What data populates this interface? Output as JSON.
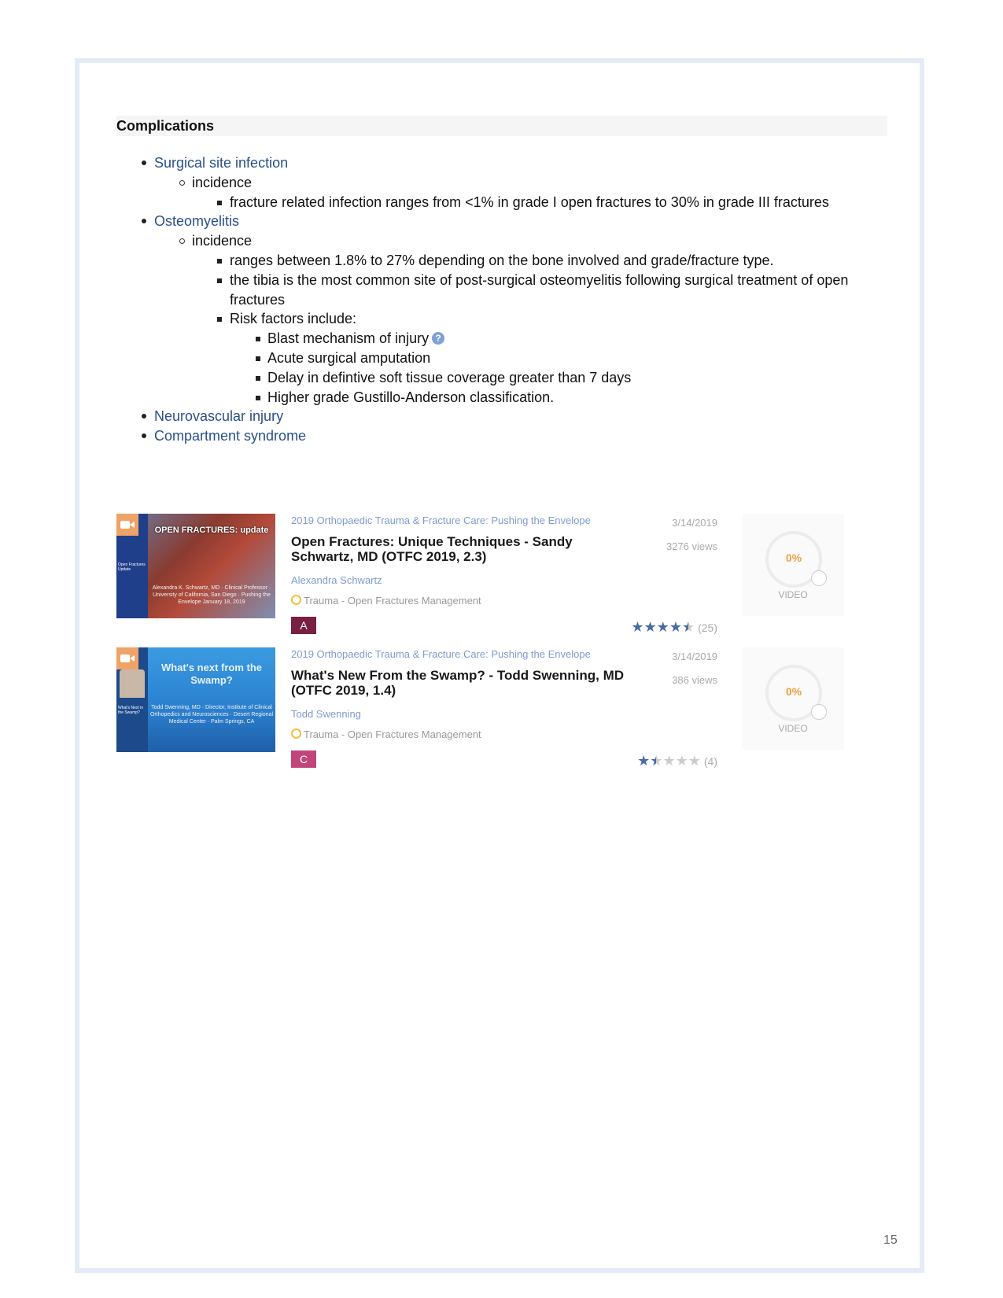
{
  "heading": "Complications",
  "outline": {
    "surgical_site_infection": "Surgical site infection",
    "ssi_incidence": "incidence",
    "ssi_detail": "fracture related infection ranges from <1% in grade I open fractures to 30% in grade III fractures",
    "osteomyelitis": "Osteomyelitis",
    "osteo_incidence": "incidence",
    "osteo_range": "ranges between 1.8% to 27% depending on the bone involved and grade/fracture type.",
    "osteo_tibia": "the tibia is the most common site of post-surgical osteomyelitis following surgical treatment of open fractures",
    "risk_factors_label": "Risk factors include:",
    "risk_factors": [
      "Blast mechanism of injury",
      "Acute surgical amputation",
      "Delay in defintive soft tissue coverage greater than 7 days",
      "Higher grade Gustillo-Anderson classification."
    ],
    "help_icon_glyph": "?",
    "neurovascular": "Neurovascular injury",
    "compartment": "Compartment syndrome"
  },
  "videos": [
    {
      "thumb_title": "OPEN FRACTURES: update",
      "thumb_sub": "Alexandra K. Schwartz, MD · Clinical Professor · University of California, San Diego · Pushing the Envelope January 18, 2019",
      "event": "2019 Orthopaedic Trauma & Fracture Care: Pushing the Envelope",
      "title": "Open Fractures: Unique Techniques - Sandy Schwartz, MD (OTFC 2019, 2.3)",
      "author": "Alexandra Schwartz",
      "topic": "Trauma - Open Fractures Management",
      "grade": "A",
      "grade_color": "#7a1f44",
      "date": "3/14/2019",
      "views": "3276 views",
      "rating": 4.5,
      "rating_count": "(25)",
      "progress": "0%",
      "progress_label": "VIDEO"
    },
    {
      "thumb_title": "What's next from the Swamp?",
      "thumb_sub": "Todd Swenning, MD · Director, Institute of Clinical Orthopedics and Neurosciences · Desert Regional Medical Center · Palm Springs, CA",
      "event": "2019 Orthopaedic Trauma & Fracture Care: Pushing the Envelope",
      "title": "What's New From the Swamp? - Todd Swenning, MD (OTFC 2019, 1.4)",
      "author": "Todd Swenning",
      "topic": "Trauma - Open Fractures Management",
      "grade": "C",
      "grade_color": "#c2457a",
      "date": "3/14/2019",
      "views": "386 views",
      "rating": 1.5,
      "rating_count": "(4)",
      "progress": "0%",
      "progress_label": "VIDEO"
    }
  ],
  "page_number": "15"
}
